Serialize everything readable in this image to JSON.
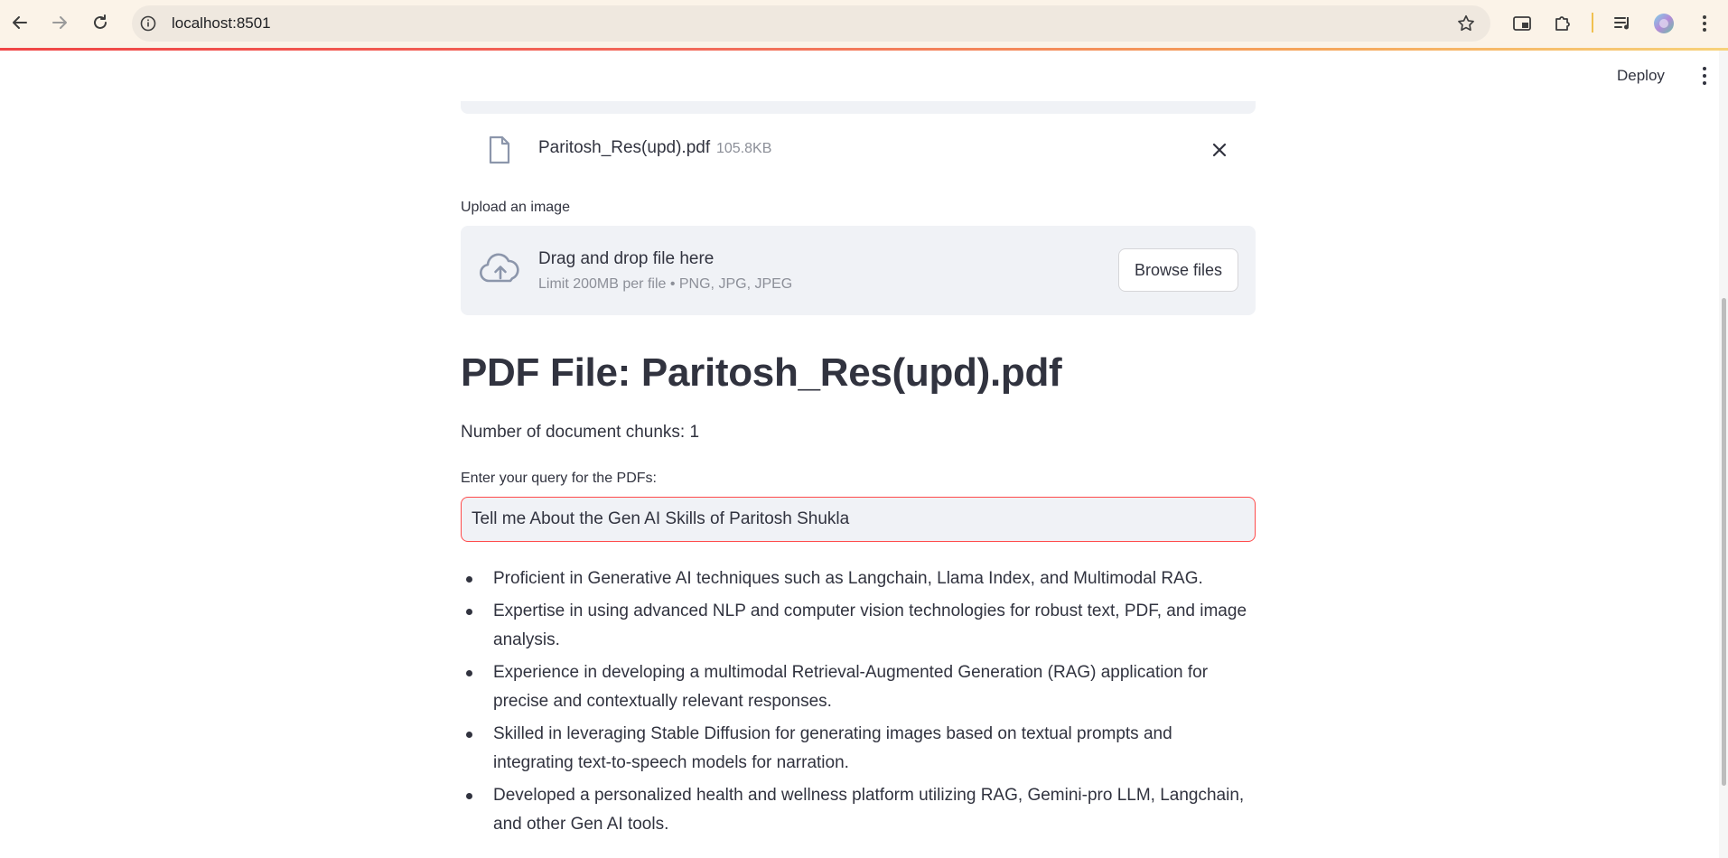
{
  "browser": {
    "url": "localhost:8501",
    "icons": [
      "back-icon",
      "forward-icon",
      "reload-icon",
      "site-info-icon",
      "bookmark-star-icon",
      "picture-in-picture-icon",
      "extensions-icon",
      "media-control-icon",
      "profile-avatar",
      "chrome-menu-icon"
    ]
  },
  "app_header": {
    "deploy_label": "Deploy"
  },
  "uploaded_pdf": {
    "file_name": "Paritosh_Res(upd).pdf",
    "file_size": "105.8KB"
  },
  "image_uploader": {
    "label": "Upload an image",
    "drop_title": "Drag and drop file here",
    "limit_text": "Limit 200MB per file • PNG, JPG, JPEG",
    "browse_label": "Browse files"
  },
  "main": {
    "heading": "PDF File: Paritosh_Res(upd).pdf",
    "chunks_text": "Number of document chunks: 1",
    "query_label": "Enter your query for the PDFs:",
    "query_value": "Tell me About the Gen AI Skills of Paritosh Shukla",
    "answers": [
      "Proficient in Generative AI techniques such as Langchain, Llama Index, and Multimodal RAG.",
      "Expertise in using advanced NLP and computer vision technologies for robust text, PDF, and image analysis.",
      "Experience in developing a multimodal Retrieval-Augmented Generation (RAG) application for precise and contextually relevant responses.",
      "Skilled in leveraging Stable Diffusion for generating images based on textual prompts and integrating text-to-speech models for narration.",
      "Developed a personalized health and wellness platform utilizing RAG, Gemini-pro LLM, Langchain, and other Gen AI tools."
    ]
  },
  "colors": {
    "accent_red": "#ff4b4b",
    "text": "#31333f",
    "muted": "#8c8f98",
    "panel_bg": "#f0f2f6"
  }
}
